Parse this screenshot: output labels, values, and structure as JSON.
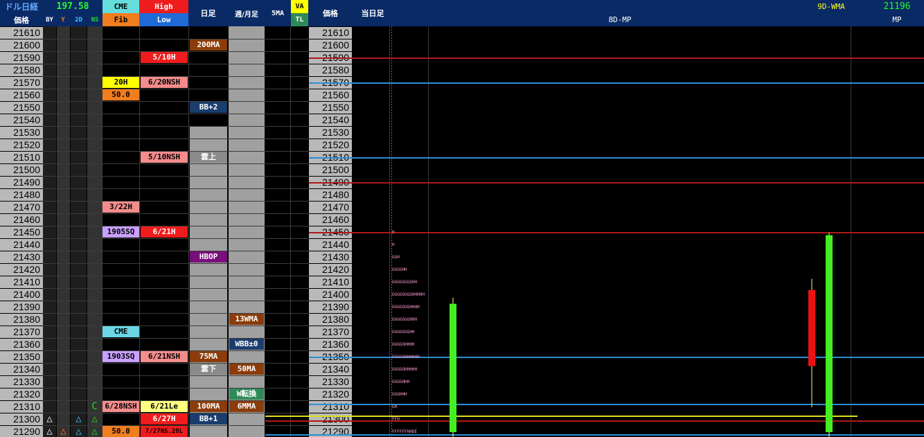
{
  "header": {
    "pair_title": "ドル日経",
    "ratio": "197.58",
    "price_label": "価格",
    "by": "BY",
    "y": "Y",
    "d2": "2D",
    "ns": "NS",
    "cme": "CME",
    "fib": "Fib",
    "high": "High",
    "low": "Low",
    "daily": "日足",
    "weekly_monthly": "週/月足",
    "ma5": "5MA",
    "va": "VA",
    "tl": "TL",
    "price_label2": "価格",
    "today": "当日足",
    "mp8d": "8D-MP",
    "wma9d": "9D-WMA",
    "mp_value": "21196",
    "mp": "MP"
  },
  "prices": [
    "21610",
    "21600",
    "21590",
    "21580",
    "21570",
    "21560",
    "21550",
    "21540",
    "21530",
    "21520",
    "21510",
    "21500",
    "21490",
    "21480",
    "21470",
    "21460",
    "21450",
    "21440",
    "21430",
    "21420",
    "21410",
    "21400",
    "21390",
    "21380",
    "21370",
    "21360",
    "21350",
    "21340",
    "21330",
    "21320",
    "21310",
    "21300",
    "21290"
  ],
  "tags": [
    {
      "name": "ma200-tag",
      "text": "200MA",
      "row": 1,
      "col": "daily",
      "bg": "#8b3c0a",
      "fg": "#ffffff"
    },
    {
      "name": "high-510h-tag",
      "text": "5/10H",
      "row": 2,
      "col": "high",
      "bg": "#ee1c1c",
      "fg": "#ffffff"
    },
    {
      "name": "cme-20h-tag",
      "text": "20H",
      "row": 4,
      "col": "cme",
      "bg": "#ffff00",
      "fg": "#000000"
    },
    {
      "name": "high-620nsh-tag",
      "text": "6/20NSH",
      "row": 4,
      "col": "high",
      "bg": "#f48c8c",
      "fg": "#000000"
    },
    {
      "name": "fib-50-tag",
      "text": "50.0",
      "row": 5,
      "col": "cme",
      "bg": "#f07d1e",
      "fg": "#000000"
    },
    {
      "name": "bb-plus2-tag",
      "text": "BB+2",
      "row": 6,
      "col": "daily",
      "bg": "#1b3d6e",
      "fg": "#ffffff"
    },
    {
      "name": "high-510nsh-tag",
      "text": "5/10NSH",
      "row": 10,
      "col": "high",
      "bg": "#f48c8c",
      "fg": "#000000"
    },
    {
      "name": "kumo-upper-tag",
      "text": "雲上",
      "row": 10,
      "col": "daily",
      "bg": "#8a8a8a",
      "fg": "#ffffff"
    },
    {
      "name": "cme-322h-tag",
      "text": "3/22H",
      "row": 14,
      "col": "cme",
      "bg": "#f48c8c",
      "fg": "#000000"
    },
    {
      "name": "cme-1905sq-tag",
      "text": "1905SQ",
      "row": 16,
      "col": "cme",
      "bg": "#c8a0ff",
      "fg": "#000000"
    },
    {
      "name": "high-621h-tag",
      "text": "6/21H",
      "row": 16,
      "col": "high",
      "bg": "#ee1c1c",
      "fg": "#ffffff"
    },
    {
      "name": "hbop-tag",
      "text": "HBOP",
      "row": 18,
      "col": "daily",
      "bg": "#7a0e7a",
      "fg": "#ffffff"
    },
    {
      "name": "wma13-tag",
      "text": "13WMA",
      "row": 23,
      "col": "weekly",
      "bg": "#8b3c0a",
      "fg": "#ffffff"
    },
    {
      "name": "cme-tag",
      "text": "CME",
      "row": 24,
      "col": "cme",
      "bg": "#6ad6e6",
      "fg": "#000000"
    },
    {
      "name": "wbb-0-tag",
      "text": "WBB±0",
      "row": 25,
      "col": "weekly",
      "bg": "#1b3d6e",
      "fg": "#ffffff"
    },
    {
      "name": "cme-1903sq-tag",
      "text": "1903SQ",
      "row": 26,
      "col": "cme",
      "bg": "#c8a0ff",
      "fg": "#000000"
    },
    {
      "name": "high-621nsh-tag",
      "text": "6/21NSH",
      "row": 26,
      "col": "high",
      "bg": "#f48c8c",
      "fg": "#000000"
    },
    {
      "name": "ma75-tag",
      "text": "75MA",
      "row": 26,
      "col": "daily",
      "bg": "#8b3c0a",
      "fg": "#ffffff"
    },
    {
      "name": "kumo-lower-tag",
      "text": "雲下",
      "row": 27,
      "col": "daily",
      "bg": "#8a8a8a",
      "fg": "#ffffff"
    },
    {
      "name": "ma50-tag",
      "text": "50MA",
      "row": 27,
      "col": "weekly",
      "bg": "#8b3c0a",
      "fg": "#ffffff"
    },
    {
      "name": "w-reversal-tag",
      "text": "W転換",
      "row": 29,
      "col": "weekly",
      "bg": "#2e8b57",
      "fg": "#ffffff"
    },
    {
      "name": "low-628nsh-tag",
      "text": "6/28NSH",
      "row": 30,
      "col": "cme",
      "bg": "#f48c8c",
      "fg": "#000000"
    },
    {
      "name": "low-621le-tag",
      "text": "6/21Le",
      "row": 30,
      "col": "high",
      "bg": "#ffff80",
      "fg": "#000000"
    },
    {
      "name": "ma100-tag",
      "text": "100MA",
      "row": 30,
      "col": "daily",
      "bg": "#8b3c0a",
      "fg": "#ffffff"
    },
    {
      "name": "ma6m-tag",
      "text": "6MMA",
      "row": 30,
      "col": "weekly",
      "bg": "#8b3c0a",
      "fg": "#ffffff"
    },
    {
      "name": "low-627h-tag",
      "text": "6/27H",
      "row": 31,
      "col": "high",
      "bg": "#ee1c1c",
      "fg": "#ffffff"
    },
    {
      "name": "bb-plus1-tag",
      "text": "BB+1",
      "row": 31,
      "col": "daily",
      "bg": "#1b3d6e",
      "fg": "#ffffff"
    },
    {
      "name": "fib-50b-tag",
      "text": "50.0",
      "row": 32,
      "col": "cme",
      "bg": "#f07d1e",
      "fg": "#000000"
    },
    {
      "name": "low-627nsl-tag",
      "text": "7/27NS.28L",
      "row": 32,
      "col": "high",
      "bg": "#ee1c1c",
      "fg": "#000000"
    }
  ],
  "markers": [
    {
      "name": "ns-c-marker",
      "text": "C",
      "row": 30,
      "col": "ns",
      "color": "#22dd22"
    },
    {
      "name": "by-triangle-marker",
      "text": "△",
      "row": 31,
      "col": "by",
      "color": "#ffffff"
    },
    {
      "name": "d2-triangle-marker",
      "text": "△",
      "row": 31,
      "col": "d2",
      "color": "#33ccff"
    },
    {
      "name": "ns-triangle-marker",
      "text": "△",
      "row": 31,
      "col": "ns",
      "color": "#22dd22"
    },
    {
      "name": "by-triangle-marker-2",
      "text": "△",
      "row": 32,
      "col": "by",
      "color": "#ffffff"
    },
    {
      "name": "y-triangle-marker",
      "text": "△",
      "row": 32,
      "col": "y",
      "color": "#ff7a1a"
    },
    {
      "name": "d2-triangle-marker-2",
      "text": "△",
      "row": 32,
      "col": "d2",
      "color": "#33ccff"
    },
    {
      "name": "ns-triangle-marker-2",
      "text": "△",
      "row": 32,
      "col": "ns",
      "color": "#22dd22"
    }
  ],
  "levels": [
    {
      "name": "level-line-21590",
      "price": 21590,
      "color": "#b01818"
    },
    {
      "name": "level-line-21570",
      "price": 21570,
      "color": "#2a8fd6"
    },
    {
      "name": "level-line-21510",
      "price": 21510,
      "color": "#2a8fd6"
    },
    {
      "name": "level-line-21490",
      "price": 21490,
      "color": "#b01818"
    },
    {
      "name": "level-line-21450",
      "price": 21450,
      "color": "#b01818"
    },
    {
      "name": "level-line-21350",
      "price": 21350,
      "color": "#2a8fd6"
    },
    {
      "name": "level-line-21312",
      "price": 21312,
      "color": "#2a8fd6"
    },
    {
      "name": "level-line-21303",
      "price": 21303,
      "color": "#e0e020"
    },
    {
      "name": "level-line-21299",
      "price": 21299,
      "color": "#b01818"
    },
    {
      "name": "level-line-21288",
      "price": 21288,
      "color": "#2a8fd6"
    }
  ],
  "profile": [
    {
      "price": 21450,
      "text": "H"
    },
    {
      "price": 21440,
      "text": "H"
    },
    {
      "price": 21430,
      "text": "GGH"
    },
    {
      "price": 21420,
      "text": "GGGGHH"
    },
    {
      "price": 21410,
      "text": "GGGGGGGGHH"
    },
    {
      "price": 21400,
      "text": "GGGGGGGGHHHHH"
    },
    {
      "price": 21390,
      "text": "GGGGGGGHHHH"
    },
    {
      "price": 21380,
      "text": "GGGGGGGHHH"
    },
    {
      "price": 21370,
      "text": "GGGGGGGHH"
    },
    {
      "price": 21360,
      "text": "GGGGGHHHH"
    },
    {
      "price": 21350,
      "text": "GGGGGHHHHHH"
    },
    {
      "price": 21340,
      "text": "GGGGGHHHHH"
    },
    {
      "price": 21330,
      "text": "GGGGHHH"
    },
    {
      "price": 21320,
      "text": "GGGHHH"
    },
    {
      "price": 21310,
      "text": "GH"
    },
    {
      "price": 21300,
      "text": "FFH"
    },
    {
      "price": 21290,
      "text": "FFFFFFHHDE"
    }
  ],
  "chart_data": {
    "type": "candlestick",
    "title": "",
    "ylabel": "価格",
    "ylim": [
      21285,
      21615
    ],
    "wma_label": "9D-WMA",
    "mp_label": "MP",
    "mp_value": 21196,
    "candles": [
      {
        "name": "day-candle-green",
        "open": 21290,
        "close": 21393,
        "high": 21398,
        "low": 21285,
        "color": "#44ee22"
      },
      {
        "name": "day-candle-red",
        "open": 21404,
        "close": 21343,
        "high": 21413,
        "low": 21310,
        "color": "#ee1111"
      },
      {
        "name": "day-candle-green-2",
        "open": 21290,
        "close": 21448,
        "high": 21450,
        "low": 21285,
        "color": "#44ee22"
      }
    ]
  }
}
